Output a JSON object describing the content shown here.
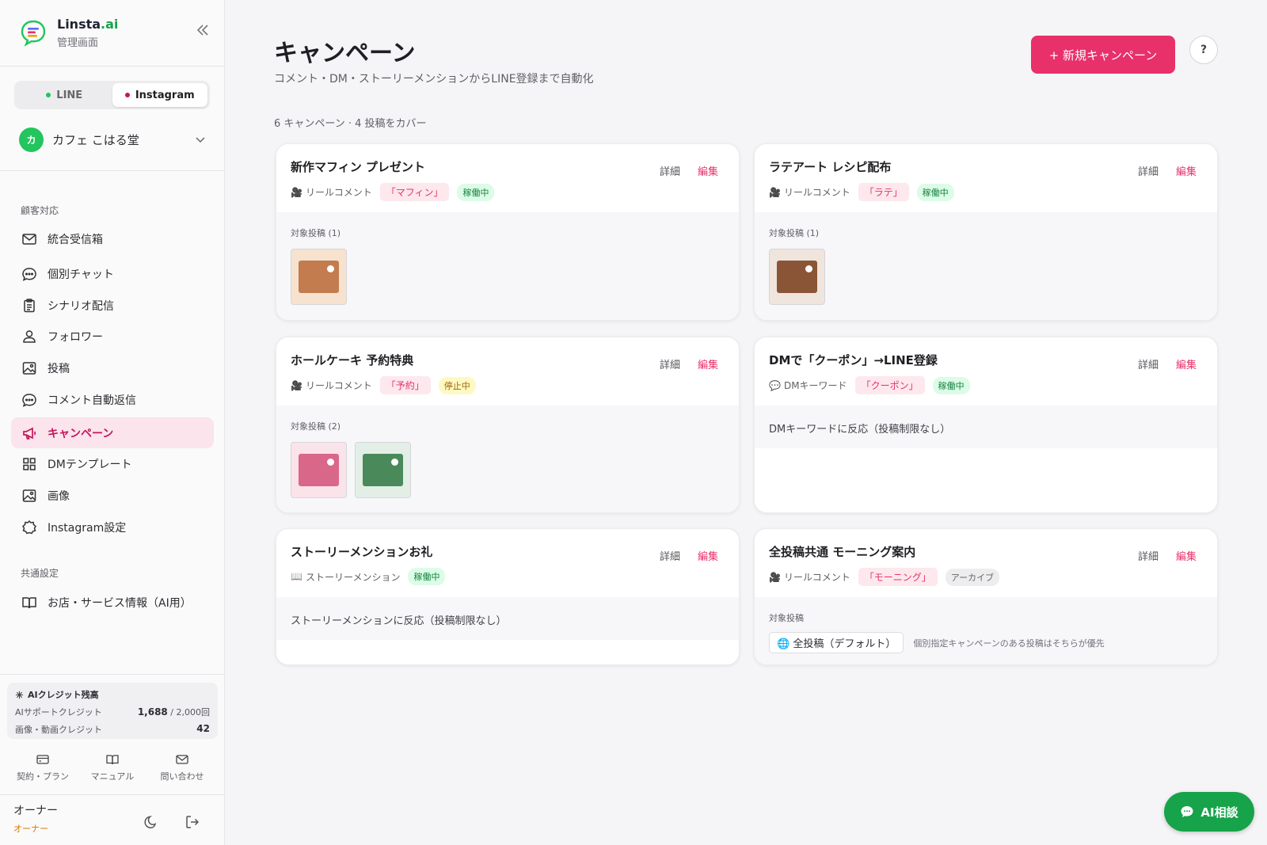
{
  "brand": {
    "name_main": "Linsta",
    "name_ai": ".ai",
    "subtitle": "管理画面"
  },
  "channels": [
    {
      "label": "LINE",
      "color": "#22c55e",
      "active": false
    },
    {
      "label": "Instagram",
      "color": "#c2185b",
      "active": true
    }
  ],
  "account": {
    "initial": "カ",
    "name": "カフェ こはる堂"
  },
  "sidebar": {
    "section_customer": "顧客対応",
    "items": [
      {
        "label": "統合受信箱",
        "icon": "mail-icon"
      },
      {
        "label": "個別チャット",
        "icon": "chat-bubble-icon"
      },
      {
        "label": "シナリオ配信",
        "icon": "clipboard-icon"
      },
      {
        "label": "フォロワー",
        "icon": "person-icon"
      },
      {
        "label": "投稿",
        "icon": "image-icon"
      },
      {
        "label": "コメント自動返信",
        "icon": "chat-bubble-icon"
      },
      {
        "label": "キャンペーン",
        "icon": "megaphone-icon",
        "active": true
      },
      {
        "label": "DMテンプレート",
        "icon": "grid-icon"
      },
      {
        "label": "画像",
        "icon": "image-icon"
      },
      {
        "label": "Instagram設定",
        "icon": "gear-icon"
      }
    ],
    "section_common": "共通設定",
    "common_items": [
      {
        "label": "お店・サービス情報（AI用）",
        "icon": "book-icon"
      }
    ]
  },
  "credits": {
    "title": "AIクレジット残高",
    "support_label": "AIサポートクレジット",
    "support_used": "1,688",
    "support_total": "/ 2,000回",
    "media_label": "画像・動画クレジット",
    "media_value": "42"
  },
  "footer_links": [
    {
      "label": "契約・プラン",
      "icon": "card-icon"
    },
    {
      "label": "マニュアル",
      "icon": "book-icon"
    },
    {
      "label": "問い合わせ",
      "icon": "mail-icon"
    }
  ],
  "user": {
    "name": "オーナー",
    "role": "オーナー"
  },
  "header": {
    "title": "キャンペーン",
    "subtitle": "コメント・DM・ストーリーメンションからLINE登録まで自動化",
    "new_button": "+ 新規キャンペーン",
    "help": "?"
  },
  "summary": "6 キャンペーン · 4 投稿をカバー",
  "actions": {
    "detail": "詳細",
    "edit": "編集"
  },
  "campaigns": [
    {
      "title": "新作マフィン プレゼント",
      "type_icon": "🎥",
      "type": "リールコメント",
      "keyword": "「マフィン」",
      "status": "稼働中",
      "status_color": "green",
      "body_label": "対象投稿 (1)",
      "thumbs": [
        {
          "bg": "#f6e2cf",
          "fg": "#c27c4e"
        }
      ]
    },
    {
      "title": "ラテアート レシピ配布",
      "type_icon": "🎥",
      "type": "リールコメント",
      "keyword": "「ラテ」",
      "status": "稼働中",
      "status_color": "green",
      "body_label": "対象投稿 (1)",
      "thumbs": [
        {
          "bg": "#efe5dc",
          "fg": "#8a5536"
        }
      ]
    },
    {
      "title": "ホールケーキ 予約特典",
      "type_icon": "🎥",
      "type": "リールコメント",
      "keyword": "「予約」",
      "status": "停止中",
      "status_color": "yellow",
      "body_label": "対象投稿 (2)",
      "thumbs": [
        {
          "bg": "#fbe3ea",
          "fg": "#d9678a"
        },
        {
          "bg": "#e3efe6",
          "fg": "#4a8a5a"
        }
      ]
    },
    {
      "title": "DMで「クーポン」→LINE登録",
      "type_icon": "💬",
      "type": "DMキーワード",
      "keyword": "「クーポン」",
      "status": "稼働中",
      "status_color": "green",
      "body_text": "DMキーワードに反応（投稿制限なし）"
    },
    {
      "title": "ストーリーメンションお礼",
      "type_icon": "📖",
      "type": "ストーリーメンション",
      "keyword": "",
      "status": "稼働中",
      "status_color": "green",
      "body_text": "ストーリーメンションに反応（投稿制限なし）"
    },
    {
      "title": "全投稿共通 モーニング案内",
      "type_icon": "🎥",
      "type": "リールコメント",
      "keyword": "「モーニング」",
      "status": "アーカイブ",
      "status_color": "gray",
      "body_label": "対象投稿",
      "default_chip": "🌐 全投稿（デフォルト）",
      "default_note": "個別指定キャンペーンのある投稿はそちらが優先"
    }
  ],
  "ai_button": "AI相談"
}
